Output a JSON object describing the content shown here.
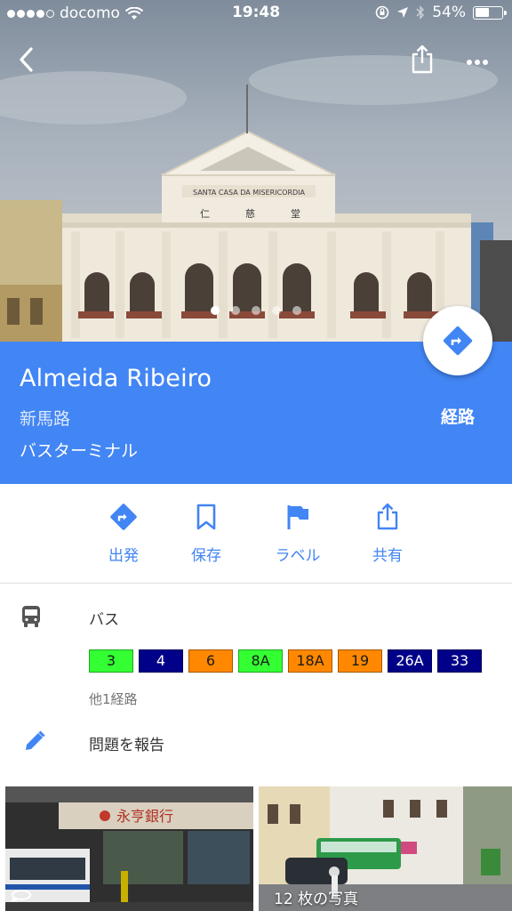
{
  "status_bar": {
    "carrier": "docomo",
    "time": "19:48",
    "battery_percent": "54%",
    "battery_level": 0.54
  },
  "hero": {
    "building_sign": "SANTA CASA DA MISERICORDIA",
    "building_chars": [
      "仁",
      "慈",
      "堂"
    ],
    "photo_pager": {
      "count": 5,
      "active_index": 0
    }
  },
  "place": {
    "title": "Almeida Ribeiro",
    "subtitle": "新馬路",
    "type": "バスターミナル",
    "route_label": "経路"
  },
  "actions": [
    {
      "id": "depart",
      "label": "出発",
      "icon": "directions-icon"
    },
    {
      "id": "save",
      "label": "保存",
      "icon": "bookmark-icon"
    },
    {
      "id": "label",
      "label": "ラベル",
      "icon": "flag-icon"
    },
    {
      "id": "share",
      "label": "共有",
      "icon": "share-icon"
    }
  ],
  "transit": {
    "label": "バス",
    "routes": [
      {
        "name": "3",
        "bg": "#33ff33",
        "fg": "#1a1a1a"
      },
      {
        "name": "4",
        "bg": "#000088",
        "fg": "#ffffff"
      },
      {
        "name": "6",
        "bg": "#ff8800",
        "fg": "#1a1a1a"
      },
      {
        "name": "8A",
        "bg": "#33ff33",
        "fg": "#1a1a1a"
      },
      {
        "name": "18A",
        "bg": "#ff8800",
        "fg": "#1a1a1a"
      },
      {
        "name": "19",
        "bg": "#ff8800",
        "fg": "#1a1a1a"
      },
      {
        "name": "26A",
        "bg": "#000088",
        "fg": "#ffffff"
      },
      {
        "name": "33",
        "bg": "#000088",
        "fg": "#ffffff"
      }
    ],
    "other_routes": "他1経路"
  },
  "report": {
    "label": "問題を報告"
  },
  "photos": {
    "count_label": "12 枚の写真",
    "shop_sign": "永亨銀行"
  },
  "colors": {
    "accent": "#4285f4"
  }
}
